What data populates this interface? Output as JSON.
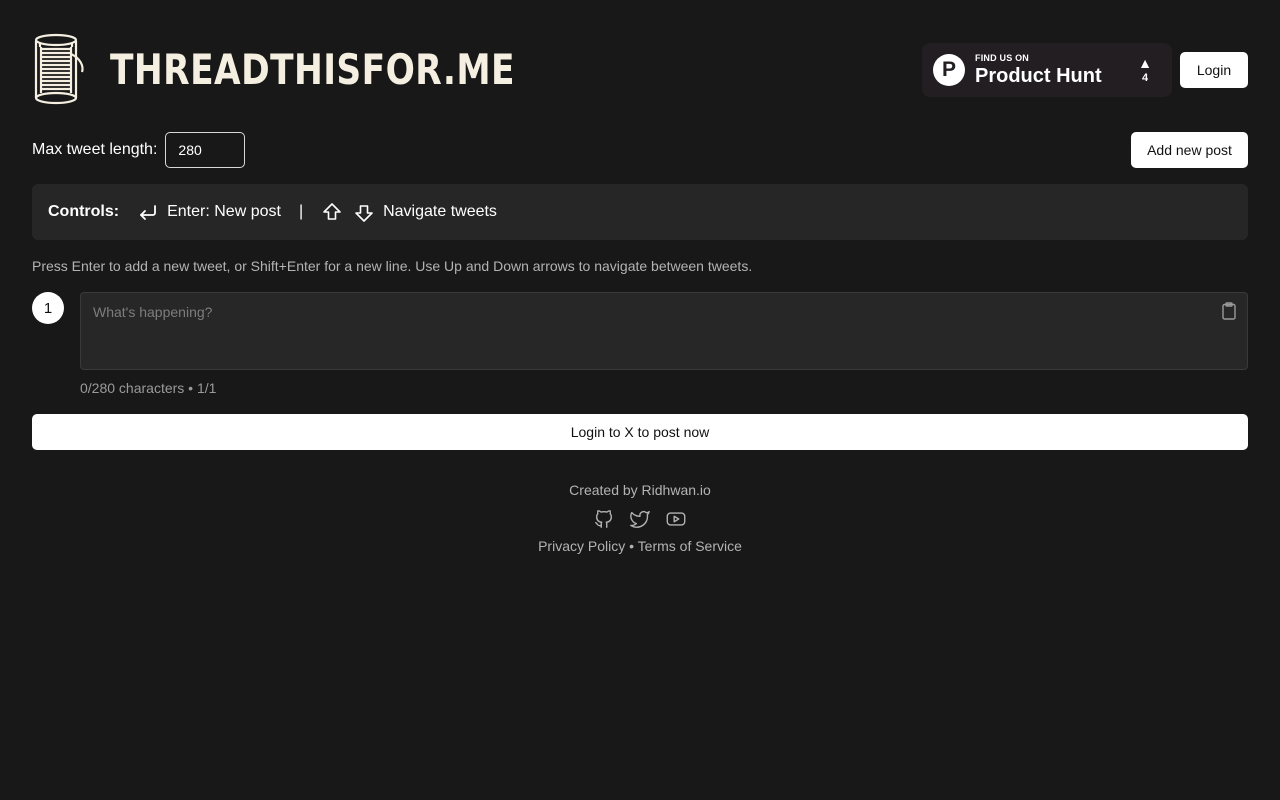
{
  "app": {
    "logo_text": "THREADTHISFOR.ME"
  },
  "product_hunt": {
    "small_text": "FIND US ON",
    "big_text": "Product Hunt",
    "logo_letter": "P",
    "arrow": "▲",
    "votes": "4"
  },
  "header": {
    "login_label": "Login"
  },
  "settings": {
    "max_length_label": "Max tweet length:",
    "max_length_value": "280",
    "add_post_label": "Add new post"
  },
  "controls": {
    "title": "Controls:",
    "enter_label": "Enter: New post",
    "separator": "|",
    "navigate_label": "Navigate tweets"
  },
  "help_text": "Press Enter to add a new tweet, or Shift+Enter for a new line. Use Up and Down arrows to navigate between tweets.",
  "tweets": [
    {
      "number": "1",
      "placeholder": "What's happening?",
      "counter": "0/280 characters • 1/1"
    }
  ],
  "post_button_label": "Login to X to post now",
  "footer": {
    "credit": "Created by Ridhwan.io",
    "social_icons": [
      "github-icon",
      "twitter-icon",
      "youtube-icon"
    ],
    "privacy": "Privacy Policy",
    "separator": "•",
    "terms": "Terms of Service"
  },
  "colors": {
    "background": "#181818",
    "panel": "#262626",
    "logo": "#f4efe1",
    "product_hunt_bg": "#231e21"
  }
}
